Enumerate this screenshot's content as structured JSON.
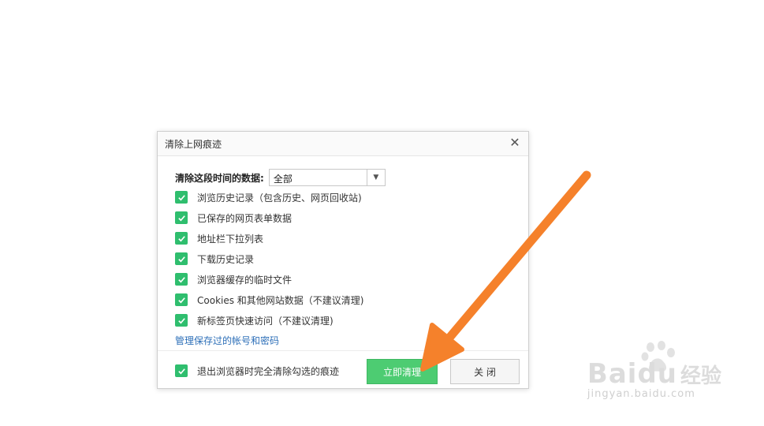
{
  "dialog": {
    "title": "清除上网痕迹",
    "range_label": "清除这段时间的数据:",
    "range_value": "全部",
    "options": [
      {
        "label": "浏览历史记录（包含历史、网页回收站)",
        "checked": true
      },
      {
        "label": "已保存的网页表单数据",
        "checked": true
      },
      {
        "label": "地址栏下拉列表",
        "checked": true
      },
      {
        "label": "下载历史记录",
        "checked": true
      },
      {
        "label": "浏览器缓存的临时文件",
        "checked": true
      },
      {
        "label": "Cookies 和其他网站数据（不建议清理)",
        "checked": true
      },
      {
        "label": "新标签页快速访问（不建议清理)",
        "checked": true
      }
    ],
    "manage_link": "管理保存过的帐号和密码",
    "exit_clear_label": "退出浏览器时完全清除勾选的痕迹",
    "exit_clear_checked": true,
    "clear_button": "立即清理",
    "close_button": "关 闭"
  },
  "watermark": {
    "logo_latin": "Bai",
    "logo_latin2": "du",
    "logo_cn": "经验",
    "url": "jingyan.baidu.com"
  },
  "colors": {
    "check": "#2fbe6e",
    "primary_button": "#4dcc72",
    "link": "#2d6fb8",
    "arrow": "#f5812b"
  }
}
